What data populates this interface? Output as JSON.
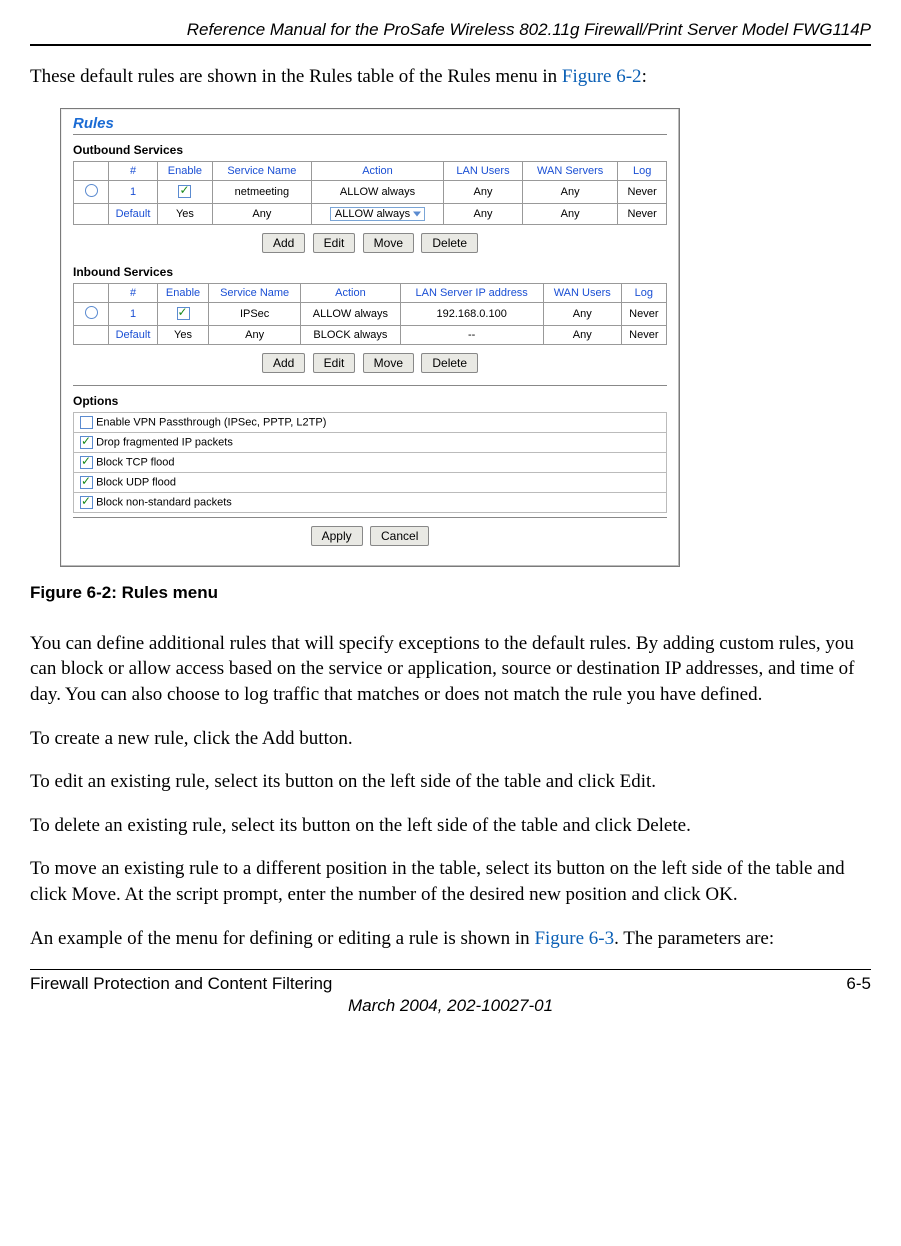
{
  "header": {
    "title": "Reference Manual for the ProSafe Wireless 802.11g  Firewall/Print Server Model FWG114P"
  },
  "intro": {
    "text_pre": "These default rules are shown in the Rules table of the Rules menu in ",
    "link": "Figure 6-2",
    "text_post": ":"
  },
  "panel": {
    "title": "Rules",
    "outbound": {
      "heading": "Outbound Services",
      "columns": [
        "",
        "#",
        "Enable",
        "Service Name",
        "Action",
        "LAN Users",
        "WAN Servers",
        "Log"
      ],
      "rows": [
        {
          "radio": true,
          "num": "1",
          "enable_checked": true,
          "service": "netmeeting",
          "action": "ALLOW always",
          "lan": "Any",
          "wan": "Any",
          "log": "Never"
        },
        {
          "default_label": "Default",
          "enable_text": "Yes",
          "service": "Any",
          "action_select": "ALLOW always",
          "lan": "Any",
          "wan": "Any",
          "log": "Never"
        }
      ],
      "buttons": [
        "Add",
        "Edit",
        "Move",
        "Delete"
      ]
    },
    "inbound": {
      "heading": "Inbound Services",
      "columns": [
        "",
        "#",
        "Enable",
        "Service Name",
        "Action",
        "LAN Server IP address",
        "WAN Users",
        "Log"
      ],
      "rows": [
        {
          "radio": true,
          "num": "1",
          "enable_checked": true,
          "service": "IPSec",
          "action": "ALLOW always",
          "lan": "192.168.0.100",
          "wan": "Any",
          "log": "Never"
        },
        {
          "default_label": "Default",
          "enable_text": "Yes",
          "service": "Any",
          "action": "BLOCK always",
          "lan": "--",
          "wan": "Any",
          "log": "Never"
        }
      ],
      "buttons": [
        "Add",
        "Edit",
        "Move",
        "Delete"
      ]
    },
    "options": {
      "heading": "Options",
      "items": [
        {
          "checked": false,
          "label": "Enable VPN Passthrough (IPSec, PPTP, L2TP)"
        },
        {
          "checked": true,
          "label": "Drop fragmented IP packets"
        },
        {
          "checked": true,
          "label": "Block TCP flood"
        },
        {
          "checked": true,
          "label": "Block UDP flood"
        },
        {
          "checked": true,
          "label": "Block non-standard packets"
        }
      ],
      "buttons": [
        "Apply",
        "Cancel"
      ]
    }
  },
  "caption": "Figure 6-2:  Rules menu",
  "body": {
    "p1": "You can define additional rules that will specify exceptions to the default rules. By adding custom rules, you can block or allow access based on the service or application, source or destination IP addresses, and time of day. You can also choose to log traffic that matches or does not match the rule you have defined.",
    "p2": "To create a new rule, click the Add button.",
    "p3": "To edit an existing rule, select its button on the left side of the table and click Edit.",
    "p4": "To delete an existing rule, select its button on the left side of the table and click Delete.",
    "p5": "To move an existing rule to a different position in the table, select its button on the left side of the table and click Move. At the script prompt, enter the number of the desired new position and click OK.",
    "p6_pre": "An example of the menu for defining or editing a rule is shown in ",
    "p6_link": "Figure 6-3",
    "p6_post": ". The parameters are:"
  },
  "footer": {
    "left": "Firewall Protection and Content Filtering",
    "right": "6-5",
    "date": "March 2004, 202-10027-01"
  }
}
